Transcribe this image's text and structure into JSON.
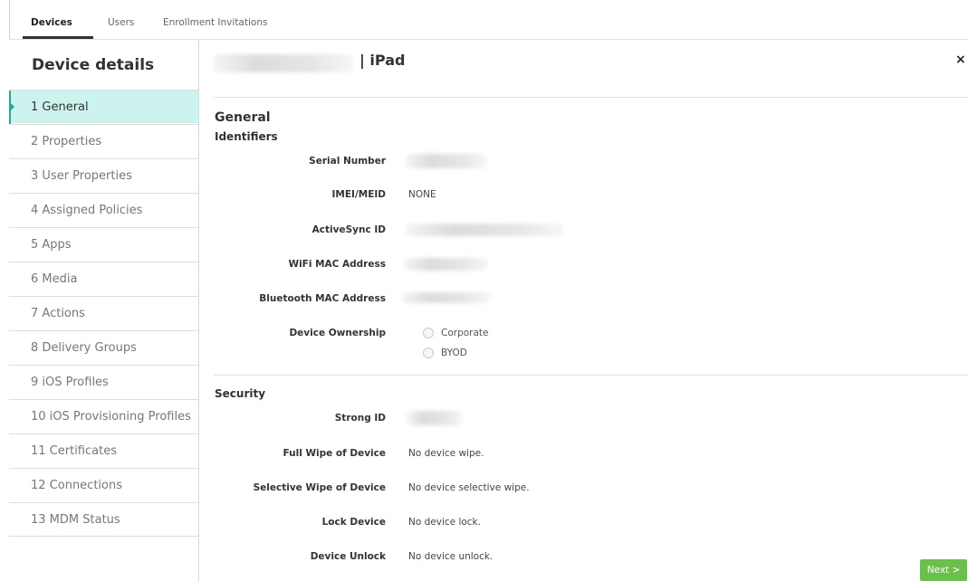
{
  "tabs": [
    {
      "label": "Devices",
      "active": true
    },
    {
      "label": "Users",
      "active": false
    },
    {
      "label": "Enrollment Invitations",
      "active": false
    }
  ],
  "sidebar": {
    "title": "Device details",
    "items": [
      {
        "label": "1 General",
        "active": true
      },
      {
        "label": "2 Properties"
      },
      {
        "label": "3 User Properties"
      },
      {
        "label": "4 Assigned Policies"
      },
      {
        "label": "5 Apps"
      },
      {
        "label": "6 Media"
      },
      {
        "label": "7 Actions"
      },
      {
        "label": "8 Delivery Groups"
      },
      {
        "label": "9 iOS Profiles"
      },
      {
        "label": "10 iOS Provisioning Profiles"
      },
      {
        "label": "11 Certificates"
      },
      {
        "label": "12 Connections"
      },
      {
        "label": "13 MDM Status"
      }
    ]
  },
  "header": {
    "device_type": "| iPad",
    "close": "×"
  },
  "general": {
    "title": "General",
    "identifiers_title": "Identifiers",
    "fields": {
      "serial_number": {
        "label": "Serial Number"
      },
      "imei_meid": {
        "label": "IMEI/MEID",
        "value": "NONE"
      },
      "activesync_id": {
        "label": "ActiveSync ID"
      },
      "wifi_mac": {
        "label": "WiFi MAC Address"
      },
      "bluetooth_mac": {
        "label": "Bluetooth MAC Address"
      },
      "device_ownership": {
        "label": "Device Ownership",
        "options": [
          "Corporate",
          "BYOD"
        ]
      }
    }
  },
  "security": {
    "title": "Security",
    "fields": {
      "strong_id": {
        "label": "Strong ID"
      },
      "full_wipe": {
        "label": "Full Wipe of Device",
        "value": "No device wipe."
      },
      "selective_wipe": {
        "label": "Selective Wipe of Device",
        "value": "No device selective wipe."
      },
      "lock_device": {
        "label": "Lock Device",
        "value": "No device lock."
      },
      "device_unlock": {
        "label": "Device Unlock",
        "value": "No device unlock."
      }
    }
  },
  "footer": {
    "next_label": "Next >"
  },
  "colors": {
    "accent": "#2aa69a",
    "active_bg": "#ccf3ee",
    "next_button": "#6bc04b"
  }
}
